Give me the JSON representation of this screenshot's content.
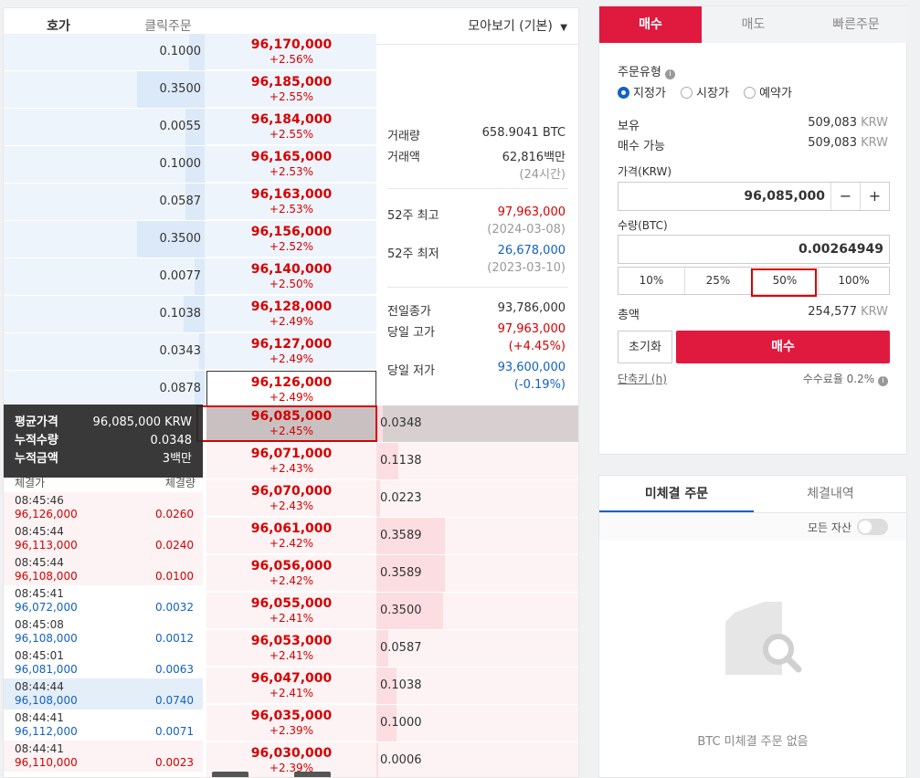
{
  "orderbook_tabs": [
    "호가",
    "클릭주문"
  ],
  "view_selector": "모아보기 (기본)",
  "asks": [
    {
      "qty": "0.1000",
      "price": "96,170,000",
      "change": "+2.56%"
    },
    {
      "qty": "0.3500",
      "price": "96,185,000",
      "change": "+2.55%"
    },
    {
      "qty": "0.0055",
      "price": "96,184,000",
      "change": "+2.55%"
    },
    {
      "qty": "0.1000",
      "price": "96,165,000",
      "change": "+2.53%"
    },
    {
      "qty": "0.0587",
      "price": "96,163,000",
      "change": "+2.53%"
    },
    {
      "qty": "0.3500",
      "price": "96,156,000",
      "change": "+2.52%"
    },
    {
      "qty": "0.0077",
      "price": "96,140,000",
      "change": "+2.50%"
    },
    {
      "qty": "0.1038",
      "price": "96,128,000",
      "change": "+2.49%"
    },
    {
      "qty": "0.0343",
      "price": "96,127,000",
      "change": "+2.49%"
    },
    {
      "qty": "0.0878",
      "price": "96,126,000",
      "change": "+2.49%"
    }
  ],
  "ask_bar_fractions": [
    0.08,
    0.35,
    0.1,
    0.1,
    0.1,
    0.35,
    0.05,
    0.11,
    0.03,
    0.05
  ],
  "bids": [
    {
      "qty": "0.0348",
      "price": "96,085,000",
      "change": "+2.45%"
    },
    {
      "qty": "0.1138",
      "price": "96,071,000",
      "change": "+2.43%"
    },
    {
      "qty": "0.0223",
      "price": "96,070,000",
      "change": "+2.43%"
    },
    {
      "qty": "0.3589",
      "price": "96,061,000",
      "change": "+2.42%"
    },
    {
      "qty": "0.3589",
      "price": "96,056,000",
      "change": "+2.42%"
    },
    {
      "qty": "0.3500",
      "price": "96,055,000",
      "change": "+2.41%"
    },
    {
      "qty": "0.0587",
      "price": "96,053,000",
      "change": "+2.41%"
    },
    {
      "qty": "0.1038",
      "price": "96,047,000",
      "change": "+2.41%"
    },
    {
      "qty": "0.1000",
      "price": "96,035,000",
      "change": "+2.39%"
    },
    {
      "qty": "0.0006",
      "price": "96,030,000",
      "change": "+2.39%"
    }
  ],
  "bid_bar_fractions": [
    0.03,
    0.11,
    0.02,
    0.34,
    0.34,
    0.33,
    0.06,
    0.1,
    0.1,
    0.01
  ],
  "info": {
    "volume_label": "거래량",
    "volume": "658.9041 BTC",
    "amount_label": "거래액",
    "amount": "62,816백만",
    "amount_note": "(24시간)",
    "high52_label": "52주 최고",
    "high52": "97,963,000",
    "high52_date": "(2024-03-08)",
    "low52_label": "52주 최저",
    "low52": "26,678,000",
    "low52_date": "(2023-03-10)",
    "prev_close_label": "전일종가",
    "prev_close": "93,786,000",
    "day_high_label": "당일 고가",
    "day_high": "97,963,000",
    "day_high_pct": "(+4.45%)",
    "day_low_label": "당일 저가",
    "day_low": "93,600,000",
    "day_low_pct": "(-0.19%)"
  },
  "tooltip": {
    "avg_label": "평균가격",
    "avg_value": "96,085,000 KRW",
    "cum_qty_label": "누적수량",
    "cum_qty_value": "0.0348",
    "cum_amt_label": "누적금액",
    "cum_amt_value": "3백만"
  },
  "trades_header": {
    "price": "체결가",
    "qty": "체결량"
  },
  "trades": [
    {
      "time": "08:45:46",
      "price": "96,126,000",
      "qty": "0.0260",
      "side": "buy"
    },
    {
      "time": "08:45:44",
      "price": "96,113,000",
      "qty": "0.0240",
      "side": "buy"
    },
    {
      "time": "08:45:44",
      "price": "96,108,000",
      "qty": "0.0100",
      "side": "buy"
    },
    {
      "time": "08:45:41",
      "price": "96,072,000",
      "qty": "0.0032",
      "side": "sell"
    },
    {
      "time": "08:45:08",
      "price": "96,108,000",
      "qty": "0.0012",
      "side": "sell"
    },
    {
      "time": "08:45:01",
      "price": "96,081,000",
      "qty": "0.0063",
      "side": "sell"
    },
    {
      "time": "08:44:44",
      "price": "96,108,000",
      "qty": "0.0740",
      "side": "sell"
    },
    {
      "time": "08:44:41",
      "price": "96,112,000",
      "qty": "0.0071",
      "side": "sell"
    },
    {
      "time": "08:44:41",
      "price": "96,110,000",
      "qty": "0.0023",
      "side": "buy"
    }
  ],
  "order": {
    "tabs": [
      "매수",
      "매도",
      "빠른주문"
    ],
    "type_label": "주문유형",
    "types": [
      "지정가",
      "시장가",
      "예약가"
    ],
    "hold_label": "보유",
    "hold_value": "509,083",
    "hold_unit": "KRW",
    "avail_label": "매수 가능",
    "avail_value": "509,083",
    "avail_unit": "KRW",
    "price_label": "가격(KRW)",
    "price_value": "96,085,000",
    "qty_label": "수량(BTC)",
    "qty_value": "0.00264949",
    "pct_buttons": [
      "10%",
      "25%",
      "50%",
      "100%"
    ],
    "total_label": "총액",
    "total_value": "254,577",
    "total_unit": "KRW",
    "reset_label": "초기화",
    "buy_label": "매수",
    "shortcut_label": "단축키 (h)",
    "fee_label": "수수료율 0.2%",
    "minus": "−",
    "plus": "+"
  },
  "pending": {
    "tabs": [
      "미체결 주문",
      "체결내역"
    ],
    "all_assets_label": "모든 자산",
    "empty_text": "BTC 미체결 주문 없음"
  },
  "colors": {
    "red": "#d60000",
    "blue": "#1261c4",
    "accent": "#e0193f"
  }
}
